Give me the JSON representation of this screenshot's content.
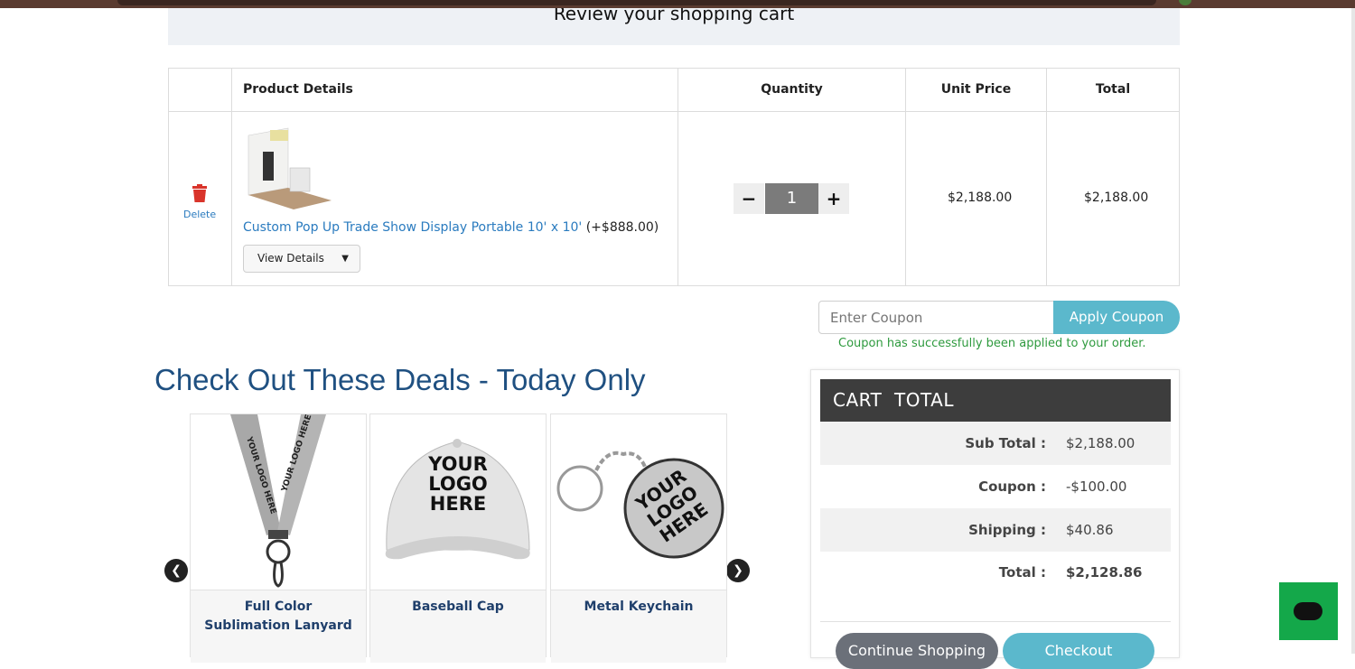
{
  "page": {
    "title": "Review your shopping cart"
  },
  "table": {
    "headers": {
      "product": "Product Details",
      "quantity": "Quantity",
      "unit_price": "Unit Price",
      "total": "Total"
    },
    "row": {
      "delete_label": "Delete",
      "product_name": "Custom Pop Up Trade Show Display Portable 10' x 10'",
      "product_extra": " (+$888.00)",
      "view_details": "View Details",
      "quantity": "1",
      "minus": "−",
      "plus": "+",
      "unit_price": "$2,188.00",
      "total": "$2,188.00"
    }
  },
  "coupon": {
    "placeholder": "Enter Coupon",
    "apply_label": "Apply Coupon",
    "success_message": "Coupon has successfully been applied to your order."
  },
  "deals": {
    "title": "Check Out These Deals - Today Only",
    "items": [
      {
        "name_line1": "Full Color",
        "name_line2": "Sublimation Lanyard",
        "logo_text": "YOUR LOGO HERE"
      },
      {
        "name_line1": "Baseball Cap",
        "name_line2": "",
        "logo_text": [
          "YOUR",
          "LOGO",
          "HERE"
        ]
      },
      {
        "name_line1": "Metal Keychain",
        "name_line2": "",
        "logo_text": [
          "YOUR",
          "LOGO",
          "HERE"
        ]
      }
    ]
  },
  "cart_total": {
    "heading": "CART  TOTAL",
    "rows": [
      {
        "label": "Sub Total :",
        "value": "$2,188.00"
      },
      {
        "label": "Coupon :",
        "value": "-$100.00"
      },
      {
        "label": "Shipping :",
        "value": "$40.86"
      },
      {
        "label": "Total :",
        "value": "$2,128.86"
      }
    ],
    "continue_label": "Continue Shopping",
    "checkout_label": "Checkout"
  },
  "colors": {
    "accent": "#5bb8cc",
    "link": "#2a7bbf",
    "success": "#2e9a3e",
    "deals_title": "#1f5081",
    "chat": "#14a84a"
  },
  "icons": [
    "trash-icon",
    "chevron-down-icon",
    "arrow-left-icon",
    "arrow-right-icon",
    "chat-icon"
  ]
}
